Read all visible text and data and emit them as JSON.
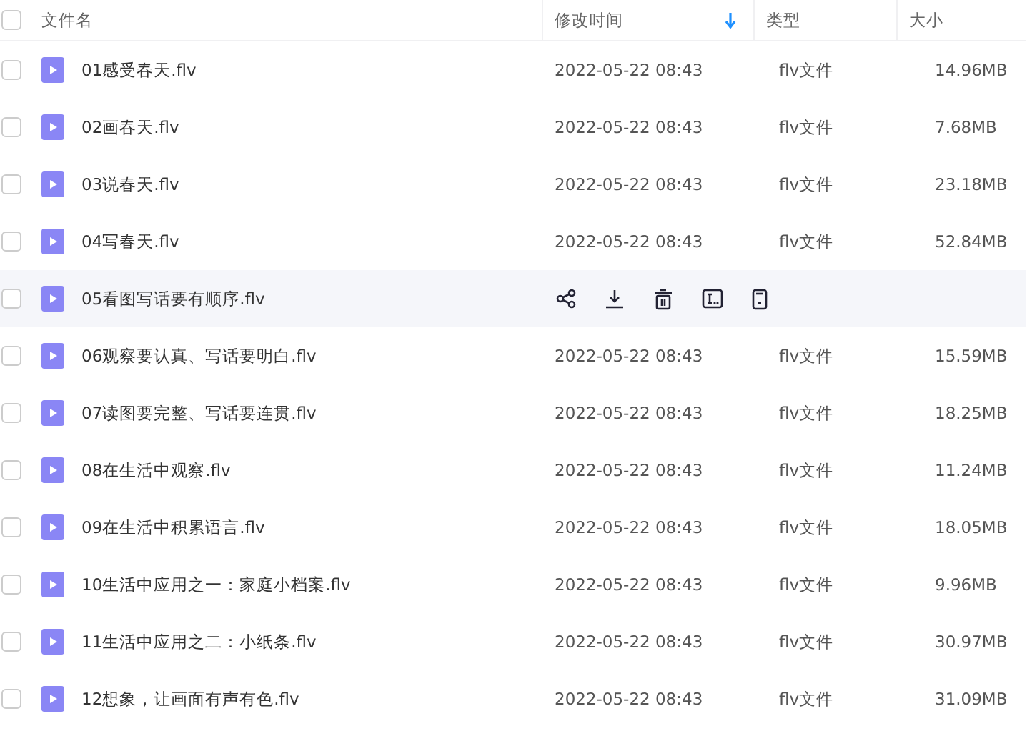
{
  "header": {
    "checked": false,
    "columns": [
      {
        "label": "文件名",
        "sorted": false
      },
      {
        "label": "修改时间",
        "sorted": true
      },
      {
        "label": "类型",
        "sorted": false
      },
      {
        "label": "大小",
        "sorted": false
      }
    ]
  },
  "rows": [
    {
      "name": "01感受春天.flv",
      "date": "2022-05-22 08:43",
      "type": "flv文件",
      "size": "14.96MB",
      "checked": false,
      "hovered": false
    },
    {
      "name": "02画春天.flv",
      "date": "2022-05-22 08:43",
      "type": "flv文件",
      "size": "7.68MB",
      "checked": false,
      "hovered": false
    },
    {
      "name": "03说春天.flv",
      "date": "2022-05-22 08:43",
      "type": "flv文件",
      "size": "23.18MB",
      "checked": false,
      "hovered": false
    },
    {
      "name": "04写春天.flv",
      "date": "2022-05-22 08:43",
      "type": "flv文件",
      "size": "52.84MB",
      "checked": false,
      "hovered": false
    },
    {
      "name": "05看图写话要有顺序.flv",
      "checked": false,
      "hovered": true
    },
    {
      "name": "06观察要认真、写话要明白.flv",
      "date": "2022-05-22 08:43",
      "type": "flv文件",
      "size": "15.59MB",
      "checked": false,
      "hovered": false
    },
    {
      "name": "07读图要完整、写话要连贯.flv",
      "date": "2022-05-22 08:43",
      "type": "flv文件",
      "size": "18.25MB",
      "checked": false,
      "hovered": false
    },
    {
      "name": "08在生活中观察.flv",
      "date": "2022-05-22 08:43",
      "type": "flv文件",
      "size": "11.24MB",
      "checked": false,
      "hovered": false
    },
    {
      "name": "09在生活中积累语言.flv",
      "date": "2022-05-22 08:43",
      "type": "flv文件",
      "size": "18.05MB",
      "checked": false,
      "hovered": false
    },
    {
      "name": "10生活中应用之一：家庭小档案.flv",
      "date": "2022-05-22 08:43",
      "type": "flv文件",
      "size": "9.96MB",
      "checked": false,
      "hovered": false
    },
    {
      "name": "11生活中应用之二：小纸条.flv",
      "date": "2022-05-22 08:43",
      "type": "flv文件",
      "size": "30.97MB",
      "checked": false,
      "hovered": false
    },
    {
      "name": "12想象，让画面有声有色.flv",
      "date": "2022-05-22 08:43",
      "type": "flv文件",
      "size": "31.09MB",
      "checked": false,
      "hovered": false
    }
  ]
}
